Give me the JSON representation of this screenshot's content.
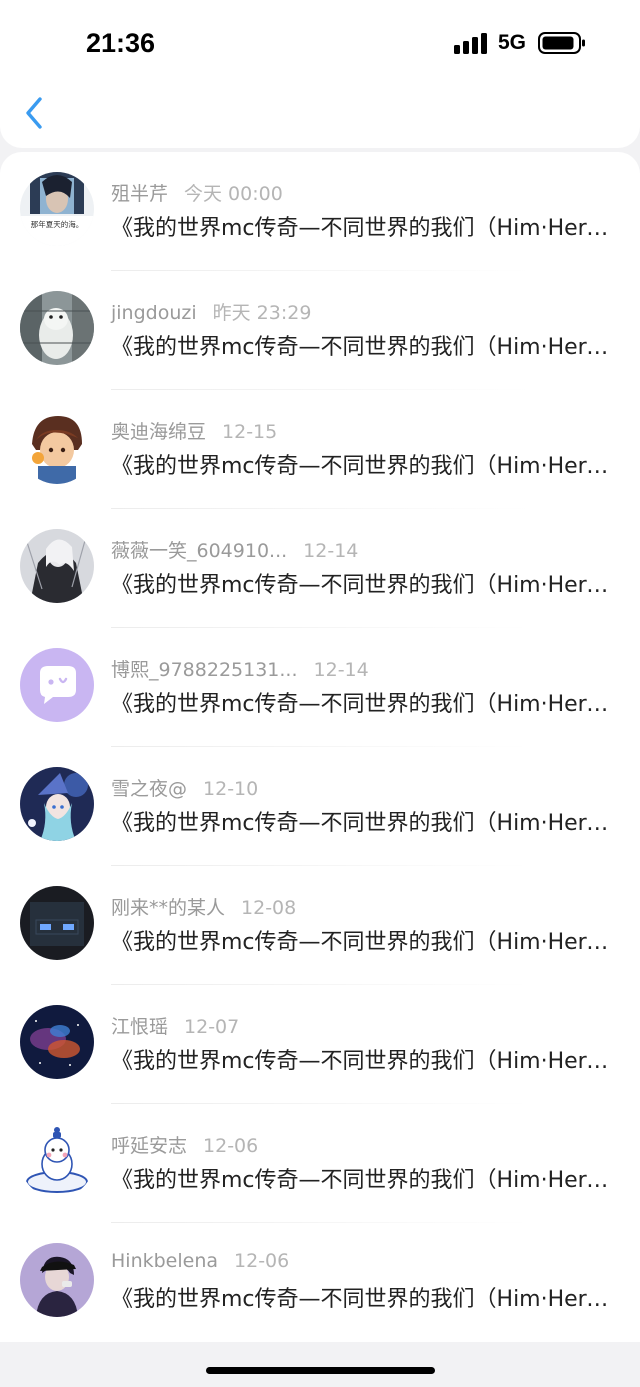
{
  "status_bar": {
    "time": "21:36",
    "network": "5G",
    "signal_icon": "cellular-signal-icon",
    "battery_icon": "battery-icon"
  },
  "nav": {
    "back_icon": "chevron-left-icon",
    "accent_color": "#3a9bf0"
  },
  "items": [
    {
      "username": "殂半芹",
      "time": "今天 00:00",
      "message": "《我的世界mc传奇—不同世界的我们（Him·Herobrine）》"
    },
    {
      "username": "jingdouzi",
      "time": "昨天 23:29",
      "message": "《我的世界mc传奇—不同世界的我们（Him·Herobrine）》"
    },
    {
      "username": "奥迪海绵豆",
      "time": "12-15",
      "message": "《我的世界mc传奇—不同世界的我们（Him·Herobrine）》"
    },
    {
      "username": "薇薇一笑_604910...",
      "time": "12-14",
      "message": "《我的世界mc传奇—不同世界的我们（Him·Herobrine）》"
    },
    {
      "username": "博熙_9788225131...",
      "time": "12-14",
      "message": "《我的世界mc传奇—不同世界的我们（Him·Herobrine）》"
    },
    {
      "username": "雪之夜@",
      "time": "12-10",
      "message": "《我的世界mc传奇—不同世界的我们（Him·Herobrine）》"
    },
    {
      "username": "刚来**的某人",
      "time": "12-08",
      "message": "《我的世界mc传奇—不同世界的我们（Him·Herobrine）》"
    },
    {
      "username": "江恨瑶",
      "time": "12-07",
      "message": "《我的世界mc传奇—不同世界的我们（Him·Herobrine）》"
    },
    {
      "username": "呼延安志",
      "time": "12-06",
      "message": "《我的世界mc传奇—不同世界的我们（Him·Herobrine）》"
    },
    {
      "username": "Hinkbelena",
      "time": "12-06",
      "message": "《我的世界mc传奇—不同世界的我们（Him·Herobrine）》"
    }
  ],
  "avatar_texts": {
    "first_avatar_caption": "那年夏天的海。"
  }
}
